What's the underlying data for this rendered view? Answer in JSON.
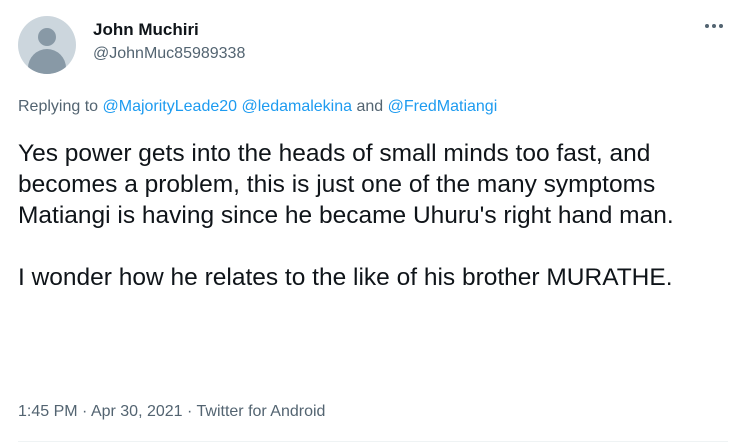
{
  "author": {
    "name": "John Muchiri",
    "handle": "@JohnMuc85989338",
    "avatar_icon": "default-avatar-icon"
  },
  "menu": {
    "more_icon": "more-options-icon"
  },
  "reply": {
    "prefix": "Replying to ",
    "mention1": "@MajorityLeade20",
    "mention2": "@ledamalekina",
    "conjunction": " and ",
    "mention3": "@FredMatiangi"
  },
  "body": {
    "paragraph1": "Yes power gets into the heads of small minds too fast, and becomes a problem, this is just one of the many symptoms Matiangi is having since he became Uhuru's right hand man.",
    "paragraph2": "I wonder how he relates to the like of his brother MURATHE."
  },
  "meta": {
    "time": "1:45 PM",
    "separator": " · ",
    "date": "Apr 30, 2021",
    "source": "Twitter for Android"
  },
  "colors": {
    "link": "#1d9bf0",
    "secondary_text": "#536471",
    "primary_text": "#0f1419"
  }
}
